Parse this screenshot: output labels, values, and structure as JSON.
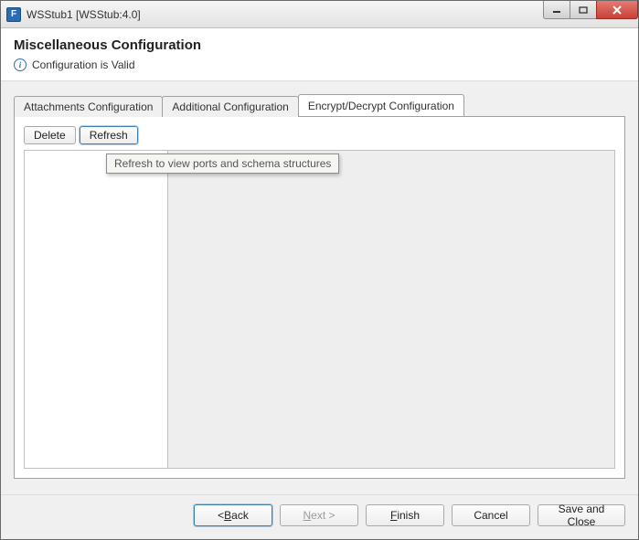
{
  "window": {
    "title": "WSStub1 [WSStub:4.0]",
    "app_icon_letter": "F"
  },
  "header": {
    "title": "Miscellaneous Configuration",
    "status": "Configuration is Valid"
  },
  "tabs": [
    {
      "label": "Attachments Configuration",
      "active": false
    },
    {
      "label": "Additional Configuration",
      "active": false
    },
    {
      "label": "Encrypt/Decrypt Configuration",
      "active": true
    }
  ],
  "toolbar": {
    "delete_label": "Delete",
    "refresh_label": "Refresh"
  },
  "tooltip": {
    "text": "Refresh to view ports and schema structures"
  },
  "footer": {
    "back": {
      "prefix": "< ",
      "mnemonic": "B",
      "suffix": "ack"
    },
    "next": {
      "mnemonic": "N",
      "suffix": "ext >"
    },
    "finish": {
      "mnemonic": "F",
      "suffix": "inish"
    },
    "cancel": {
      "label": "Cancel"
    },
    "save_close": {
      "label": "Save and Close"
    }
  }
}
